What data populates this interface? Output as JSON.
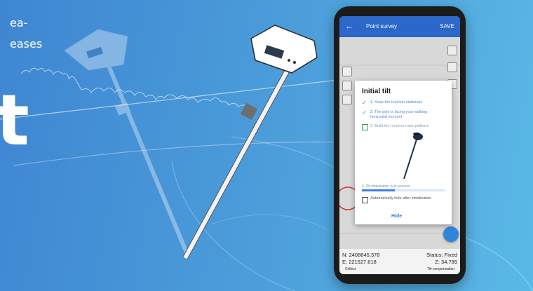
{
  "copy": {
    "line1": "ea-",
    "line2": "eases",
    "headline_fragment": "t"
  },
  "phone": {
    "appbar": {
      "back_icon": "arrow-left-icon",
      "title": "Point survey",
      "ok": "SAVE"
    },
    "dialog": {
      "title": "Initial tilt",
      "steps": [
        {
          "state": "done",
          "icon": "check-icon",
          "text": "1. Keep the receiver stationary"
        },
        {
          "state": "done",
          "icon": "check-icon",
          "text": "2. The pole is facing your walking horizontal moment"
        },
        {
          "state": "pending",
          "icon": "checkbox-icon",
          "text": "3. Build the receiver track platform"
        }
      ],
      "progress_caption": "4. Tilt initialization is in process",
      "progress_percent": 40,
      "auto_hide_label": "Automatically hide after initialization",
      "hide_button": "Hide"
    },
    "readout": {
      "north": "N: 2408645.378",
      "east": "E: 221527.618",
      "status": "Status: Fixed",
      "z": "Z: 34.785"
    },
    "bottom": {
      "left": "Collect",
      "right": "Tilt compensation"
    }
  },
  "colors": {
    "background_left": "#3f86d2",
    "background_right": "#5ab9e6",
    "appbar": "#2b68c9",
    "accent": "#2f86d8"
  }
}
